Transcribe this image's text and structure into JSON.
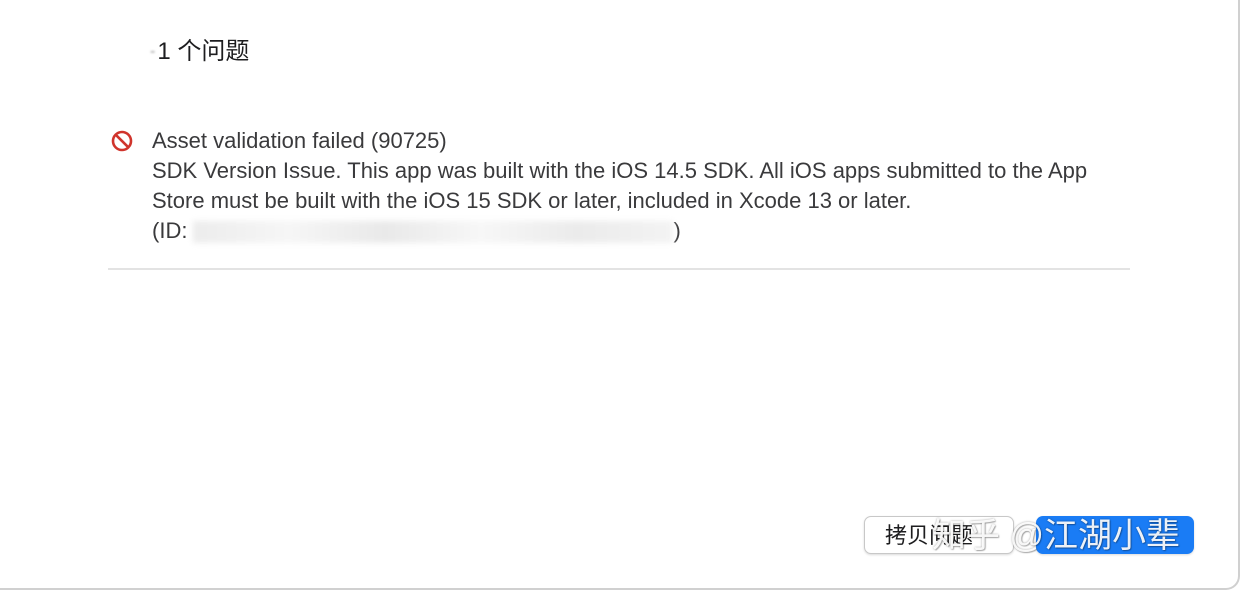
{
  "header": {
    "count_text": "1 个问题"
  },
  "issue": {
    "title": "Asset validation failed (90725)",
    "message": "SDK Version Issue. This app was built with the iOS 14.5 SDK. All iOS apps submitted to the App Store must be built with the iOS 15 SDK or later, included in Xcode 13 or later.",
    "id_prefix": "(ID:",
    "id_suffix": ")",
    "icon": "error-prohibited-icon",
    "icon_color": "#d0342c"
  },
  "buttons": {
    "copy_label": "拷贝问题",
    "done_color": "#1a7cf5"
  },
  "watermark": {
    "text": "知乎 @江湖小辈"
  }
}
